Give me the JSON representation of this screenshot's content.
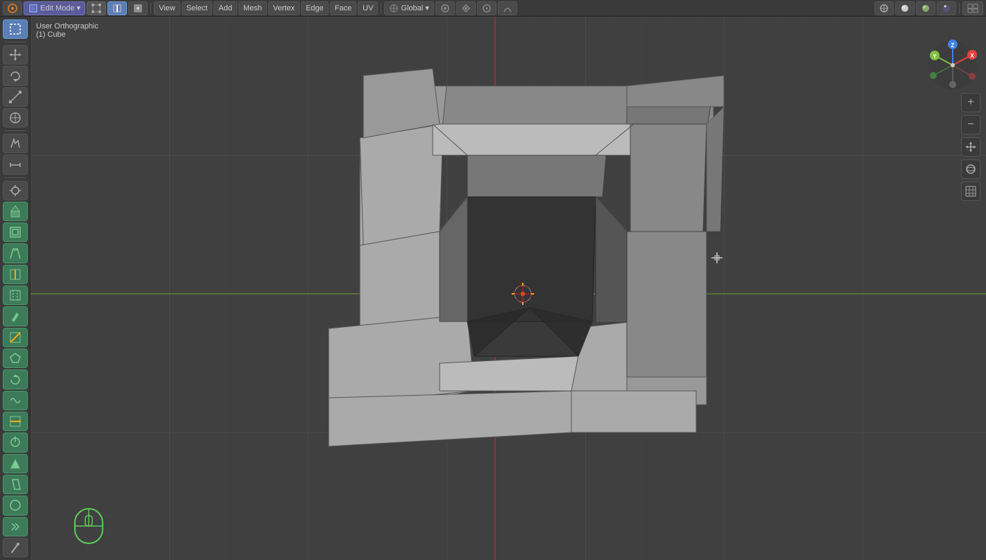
{
  "topbar": {
    "mode_label": "Edit Mode",
    "view_label": "View",
    "select_label": "Select",
    "add_label": "Add",
    "mesh_label": "Mesh",
    "vertex_label": "Vertex",
    "edge_label": "Edge",
    "face_label": "Face",
    "uv_label": "UV",
    "transform_label": "Global",
    "snap_icon": "magnet",
    "proportional_icon": "circle"
  },
  "viewport": {
    "view_name": "User Orthographic",
    "object_name": "(1) Cube"
  },
  "sidebar": {
    "tools": [
      {
        "name": "select-box",
        "icon": "⊹",
        "active": true
      },
      {
        "name": "move",
        "icon": "✛"
      },
      {
        "name": "rotate",
        "icon": "↻"
      },
      {
        "name": "scale",
        "icon": "⤡"
      },
      {
        "name": "transform",
        "icon": "⊕"
      },
      {
        "name": "annotate",
        "icon": "✏"
      },
      {
        "name": "measure",
        "icon": "📏"
      },
      {
        "name": "separator1"
      },
      {
        "name": "cursor",
        "icon": "◎"
      },
      {
        "name": "extrude",
        "icon": "▲"
      },
      {
        "name": "inset",
        "icon": "◱"
      },
      {
        "name": "bevel",
        "icon": "◧"
      },
      {
        "name": "loop-cut",
        "icon": "⊞"
      },
      {
        "name": "offset-edge-cut",
        "icon": "⊟"
      },
      {
        "name": "knife",
        "icon": "✂"
      },
      {
        "name": "bisect",
        "icon": "⧖"
      },
      {
        "name": "poly-build",
        "icon": "◫"
      },
      {
        "name": "spin",
        "icon": "⟳"
      },
      {
        "name": "smooth",
        "icon": "≈"
      },
      {
        "name": "edge-slide",
        "icon": "↔"
      },
      {
        "name": "shrink-fatten",
        "icon": "⊙"
      },
      {
        "name": "push-pull",
        "icon": "↕"
      },
      {
        "name": "shear",
        "icon": "◈"
      },
      {
        "name": "to-sphere",
        "icon": "○"
      },
      {
        "name": "rip-region",
        "icon": "◁"
      },
      {
        "name": "grease-pencil",
        "icon": "✍"
      }
    ]
  },
  "gizmo": {
    "x_color": "#e84040",
    "y_color": "#80c040",
    "z_color": "#4080e8",
    "x_label": "X",
    "y_label": "Y",
    "z_label": "Z"
  },
  "right_tools": [
    {
      "name": "render-icon",
      "icon": "📷"
    },
    {
      "name": "viewport-display",
      "icon": "👁"
    },
    {
      "name": "snap-grid",
      "icon": "⊞"
    },
    {
      "name": "overlay",
      "icon": "◉"
    }
  ],
  "mouse_hint": {
    "icon": "mouse",
    "label": ""
  }
}
